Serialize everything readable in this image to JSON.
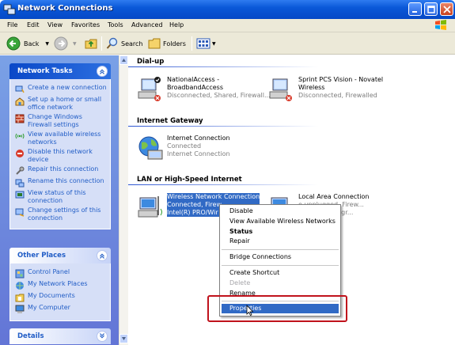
{
  "window": {
    "title": "Network Connections"
  },
  "menu": [
    "File",
    "Edit",
    "View",
    "Favorites",
    "Tools",
    "Advanced",
    "Help"
  ],
  "toolbar": {
    "back": "Back",
    "search": "Search",
    "folders": "Folders"
  },
  "left": {
    "network_tasks": {
      "title": "Network Tasks",
      "items": [
        "Create a new connection",
        "Set up a home or small office network",
        "Change Windows Firewall settings",
        "View available wireless networks",
        "Disable this network device",
        "Repair this connection",
        "Rename this connection",
        "View status of this connection",
        "Change settings of this connection"
      ]
    },
    "other_places": {
      "title": "Other Places",
      "items": [
        "Control Panel",
        "My Network Places",
        "My Documents",
        "My Computer"
      ]
    },
    "details": {
      "title": "Details"
    }
  },
  "groups": {
    "dialup": {
      "title": "Dial-up",
      "items": [
        {
          "name1": "NationalAccess -",
          "name2": "BroadbandAccess",
          "status": "Disconnected, Shared, Firewall..."
        },
        {
          "name1": "Sprint PCS Vision - Novatel",
          "name2": "Wireless",
          "status": "Disconnected, Firewalled"
        }
      ]
    },
    "gateway": {
      "title": "Internet Gateway",
      "items": [
        {
          "name1": "Internet Connection",
          "name2": "Connected",
          "status": "Internet Connection"
        }
      ]
    },
    "lan": {
      "title": "LAN or High-Speed Internet",
      "items": [
        {
          "name1": "Wireless Network Connection",
          "name2": "Connected, Firew",
          "status": "Intel(R) PRO/Wir"
        },
        {
          "name1": "Local Area Connection",
          "name2": "e unplugged, Firew...",
          "status": "x Gigabit Integr..."
        }
      ]
    }
  },
  "context_menu": {
    "items": [
      "Disable",
      "View Available Wireless Networks",
      "Status",
      "Repair",
      "Bridge Connections",
      "Create Shortcut",
      "Delete",
      "Rename",
      "Properties"
    ],
    "highlighted": "Properties"
  }
}
